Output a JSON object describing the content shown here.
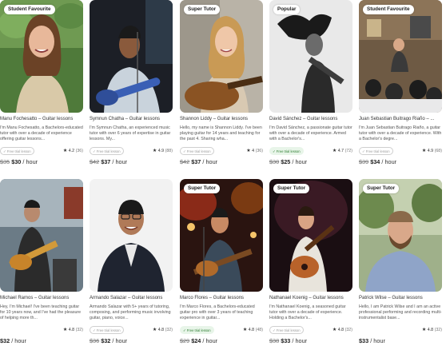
{
  "cards": [
    {
      "badge": "Student Favourite",
      "name": "Manu Fochesatto – Guitar lessons",
      "desc": "I'm Manu Fochesatto, a Bachelors-educated tutor with over a decade of experience offering guitar lessons...",
      "trial": "Free trial lesson",
      "rating": "4.2",
      "count": "(36)",
      "old_price": "$35",
      "price": "$30",
      "per": "/ hour"
    },
    {
      "badge": "",
      "name": "Symnun Chatha – Guitar lessons",
      "desc": "I'm Symnun Chatha, an experienced music tutor with over 6 years of expertise in guitar lessons. My...",
      "trial": "Free trial lesson",
      "rating": "4.9",
      "count": "(88)",
      "old_price": "$42",
      "price": "$37",
      "per": "/ hour"
    },
    {
      "badge": "Super Tutor",
      "name": "Shannon Liddy – Guitar lessons",
      "desc": "Hello, my name is Shannon Liddy. I've been playing guitar for 14 years and teaching for the past 4. Sharing wha...",
      "trial": "Free trial lesson",
      "rating": "4",
      "count": "(36)",
      "old_price": "$42",
      "price": "$37",
      "per": "/ hour"
    },
    {
      "badge": "Popular",
      "name": "David Sánchez – Guitar lessons",
      "desc": "I'm David Sánchez, a passionate guitar tutor with over a decade of experience. Armed with a Bachelor's...",
      "trial": "Free trial lesson",
      "rating": "4.7",
      "count": "(72)",
      "old_price": "$30",
      "price": "$25",
      "per": "/ hour"
    },
    {
      "badge": "Student Favourite",
      "name": "Juan Sebastian Buitrago Riaño – ...",
      "desc": "I'm Juan Sebastian Buitrago Riaño, a guitar tutor with over a decade of experience. With a Bachelor's degre...",
      "trial": "Free trial lesson",
      "rating": "4.9",
      "count": "(68)",
      "old_price": "$39",
      "price": "$34",
      "per": "/ hour"
    },
    {
      "badge": "",
      "name": "Michael Ramos – Guitar lessons",
      "desc": "Hey, I'm Michael! I've been teaching guitar for 10 years now, and I've had the pleasure of helping more th...",
      "trial": "",
      "rating": "4.8",
      "count": "(32)",
      "old_price": "",
      "price": "$32",
      "per": "/ hour"
    },
    {
      "badge": "",
      "name": "Armando Salazar – Guitar lessons",
      "desc": "Armando Salazar with 5+ years of tutoring, composing, and performing music involving guitar, piano, voice...",
      "trial": "Free trial lesson",
      "rating": "4.8",
      "count": "(32)",
      "old_price": "$36",
      "price": "$32",
      "per": "/ hour"
    },
    {
      "badge": "Super Tutor",
      "name": "Marco Flores – Guitar lessons",
      "desc": "I'm Marco Flores, a Bachelors-educated guitar pro with over 3 years of teaching experience in guitar...",
      "trial": "Free trial lesson",
      "rating": "4.8",
      "count": "(48)",
      "old_price": "$29",
      "price": "$24",
      "per": "/ hour"
    },
    {
      "badge": "Super Tutor",
      "name": "Nathanael Koenig – Guitar lessons",
      "desc": "I'm Nathanael Koenig, a seasoned guitar tutor with over a decade of experience. Holding a Bachelor's...",
      "trial": "Free trial lesson",
      "rating": "4.8",
      "count": "(32)",
      "old_price": "$38",
      "price": "$33",
      "per": "/ hour"
    },
    {
      "badge": "Super Tutor",
      "name": "Patrick Wilse – Guitar lessons",
      "desc": "Hello, I am Patrick Wilse and I am an active professional performing and recording multi-instrumentalist base...",
      "trial": "",
      "rating": "4.8",
      "count": "(32)",
      "old_price": "",
      "price": "$33",
      "per": "/ hour"
    }
  ],
  "colors": {
    "trial_green_bg": "#e8f5e9",
    "trial_green_text": "#2e7d32",
    "badge_bg": "#ffffff"
  },
  "icons": {
    "star": "star-icon",
    "trial_check": "check-icon"
  }
}
